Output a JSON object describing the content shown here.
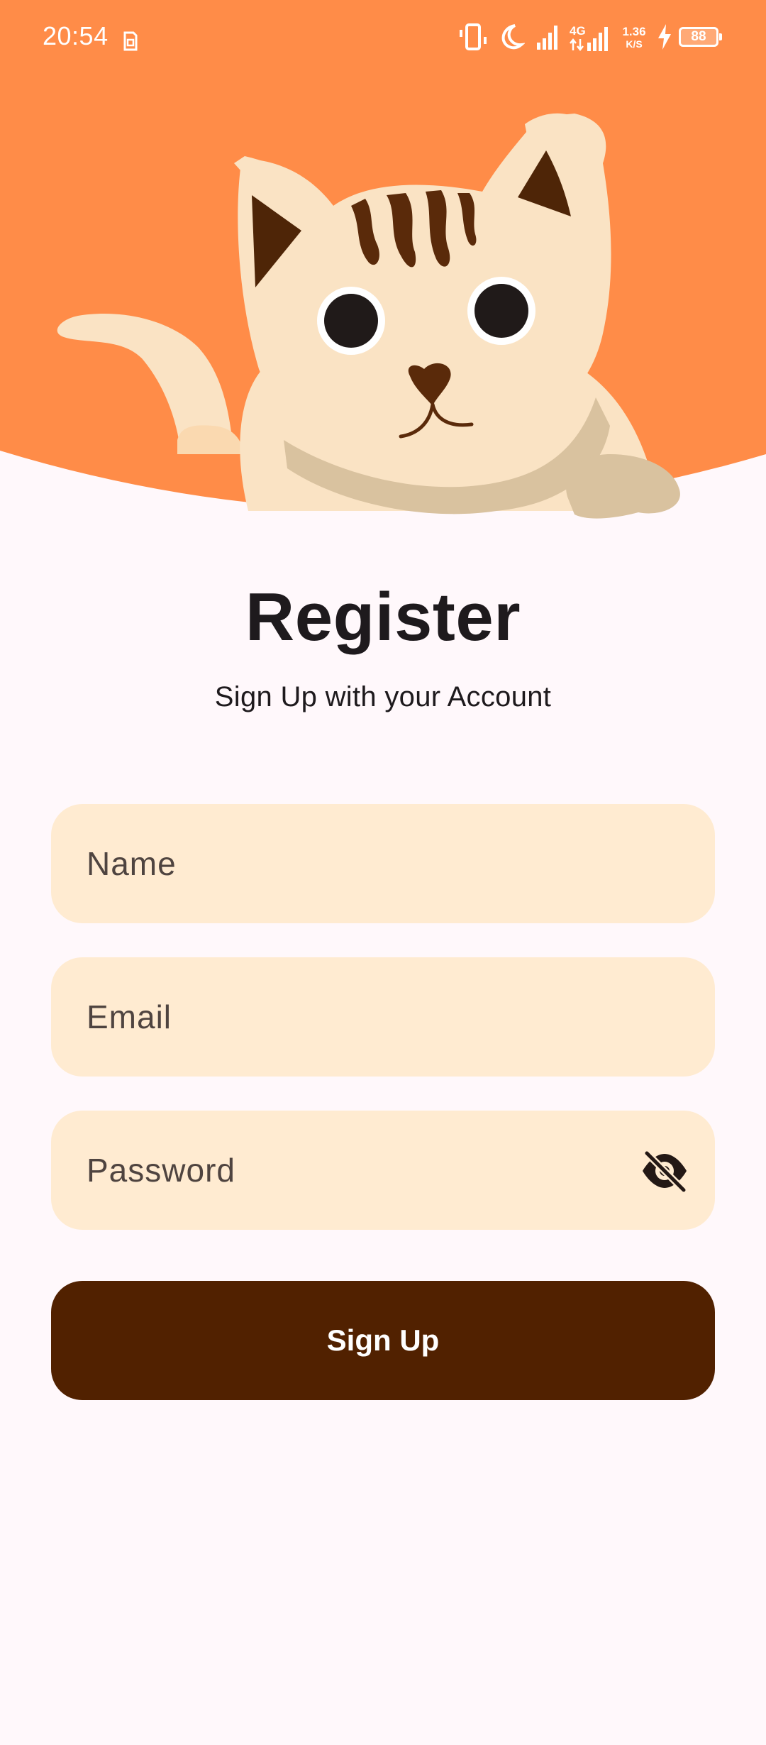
{
  "status_bar": {
    "time": "20:54",
    "network_speed_value": "1.36",
    "network_speed_unit": "K/S",
    "network_type": "4G",
    "battery_level": "88",
    "icons": [
      "sim-icon",
      "vibrate-icon",
      "moon-icon",
      "signal-icon",
      "signal-4g-icon",
      "network-speed-icon",
      "charging-icon",
      "battery-icon"
    ]
  },
  "header": {
    "illustration": "cat-illustration",
    "background_color": "#FF8C48"
  },
  "title": "Register",
  "subtitle": "Sign Up with your Account",
  "form": {
    "name_placeholder": "Name",
    "email_placeholder": "Email",
    "password_placeholder": "Password",
    "password_toggle_icon": "eye-off-icon"
  },
  "signup_button": {
    "label": "Sign Up",
    "color": "#512100"
  },
  "colors": {
    "background": "#FFF8FB",
    "field_background": "#FFEBD1",
    "title_text": "#1E1A1D"
  }
}
